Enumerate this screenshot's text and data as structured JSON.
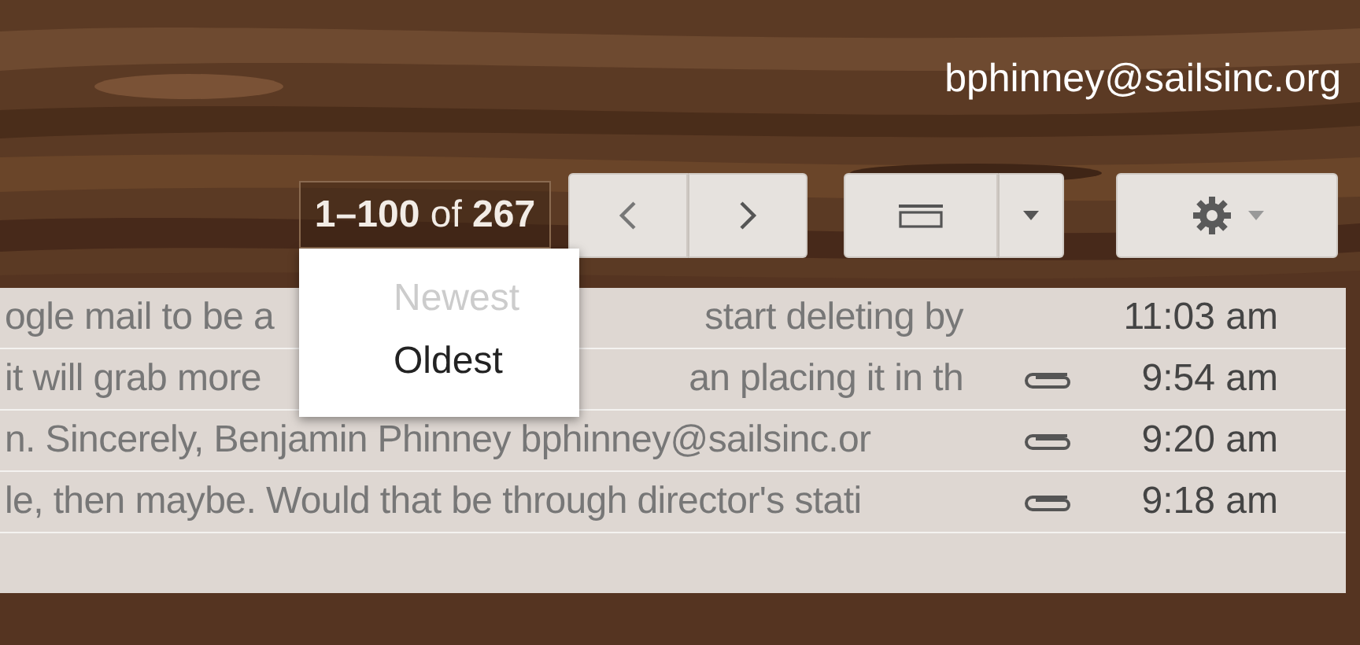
{
  "account": {
    "email": "bphinney@sailsinc.org"
  },
  "toolbar": {
    "range": {
      "text": "**1–100** of **267**",
      "expanded": true
    }
  },
  "sort_menu": {
    "items": [
      {
        "label": "Newest",
        "disabled": true
      },
      {
        "label": "Oldest",
        "disabled": false
      }
    ]
  },
  "messages": [
    {
      "snippet_start": "ogle mail to be a",
      "snippet_end": "start deleting by",
      "attachment": false,
      "time": "11:03 am"
    },
    {
      "snippet_start": "it will grab more",
      "snippet_end": "an placing it in th",
      "attachment": true,
      "time": "9:54 am"
    },
    {
      "snippet_start": "n. Sincerely, Benjamin Phinney bphinney@sailsinc.or",
      "attachment": true,
      "time": "9:20 am"
    },
    {
      "snippet_start": "le, then maybe. Would that be through director's stati",
      "attachment": true,
      "time": "9:18 am"
    }
  ]
}
